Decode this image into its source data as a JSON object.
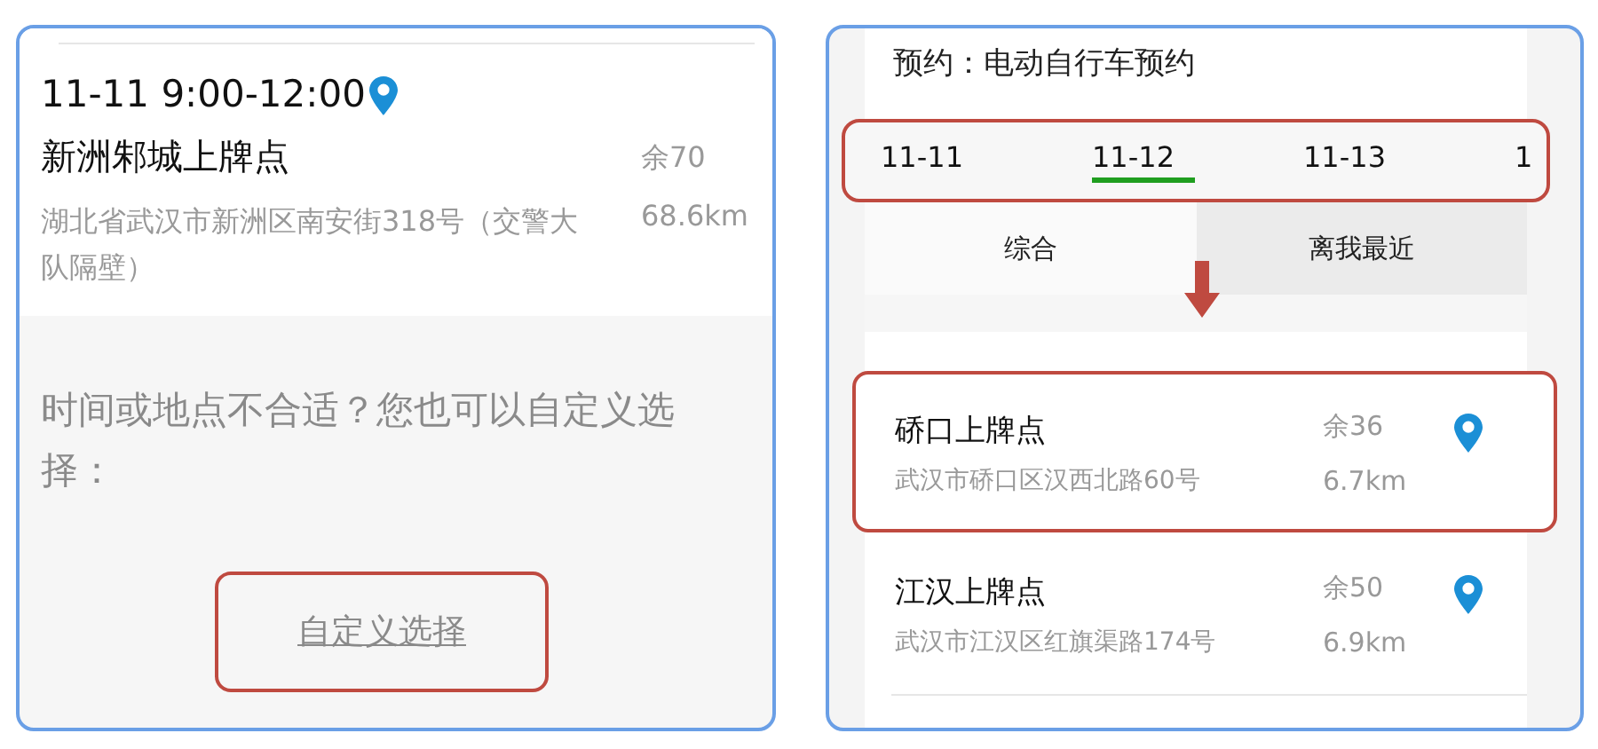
{
  "left_panel": {
    "time_slot": "11-11 9:00-12:00",
    "station": {
      "name": "新洲邾城上牌点",
      "remaining": "余70",
      "address": "湖北省武汉市新洲区南安街318号（交警大队隔壁）",
      "distance": "68.6km"
    },
    "prompt": "时间或地点不合适？您也可以自定义选择：",
    "custom_button": {
      "label": "自定义选择",
      "highlighted": true
    }
  },
  "right_panel": {
    "header": "预约：电动自行车预约",
    "date_tabs": {
      "highlighted": true,
      "items": [
        {
          "label": "11-11",
          "selected": false
        },
        {
          "label": "11-12",
          "selected": true
        },
        {
          "label": "11-13",
          "selected": false
        },
        {
          "label": "1",
          "selected": false
        }
      ]
    },
    "sort_tabs": [
      {
        "label": "综合",
        "selected": false
      },
      {
        "label": "离我最近",
        "selected": true
      }
    ],
    "stations": [
      {
        "name": "硚口上牌点",
        "address": "武汉市硚口区汉西北路60号",
        "remaining": "余36",
        "distance": "6.7km",
        "highlighted": true
      },
      {
        "name": "江汉上牌点",
        "address": "武汉市江汉区红旗渠路174号",
        "remaining": "余50",
        "distance": "6.9km",
        "highlighted": false
      }
    ]
  }
}
